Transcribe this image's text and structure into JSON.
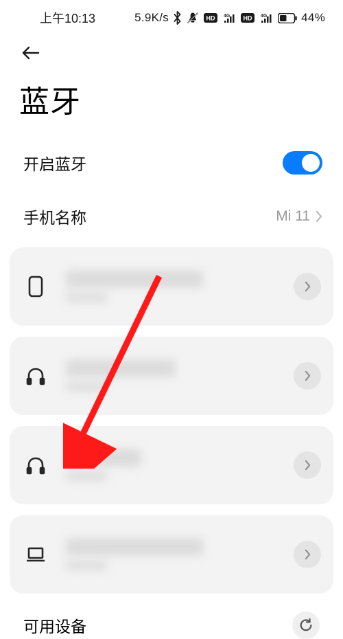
{
  "status": {
    "time": "上午10:13",
    "net_speed": "5.9K/s",
    "battery_pct": "44%"
  },
  "page": {
    "title": "蓝牙"
  },
  "bluetooth": {
    "enable_label": "开启蓝牙",
    "enabled": true
  },
  "phone_name": {
    "label": "手机名称",
    "value": "Mi 11"
  },
  "paired_devices": [
    {
      "type": "phone"
    },
    {
      "type": "headphones"
    },
    {
      "type": "headphones"
    },
    {
      "type": "laptop"
    }
  ],
  "available": {
    "label": "可用设备"
  },
  "icons": {
    "bluetooth": "bluetooth-icon",
    "mute": "mute-icon",
    "hd": "HD",
    "sig_4g": "4G",
    "battery": "battery-icon",
    "back": "back-arrow-icon",
    "chevron_right": "chevron-right-icon",
    "refresh": "refresh-icon",
    "phone": "phone-outline-icon",
    "headphones": "headphones-icon",
    "laptop": "laptop-icon"
  }
}
